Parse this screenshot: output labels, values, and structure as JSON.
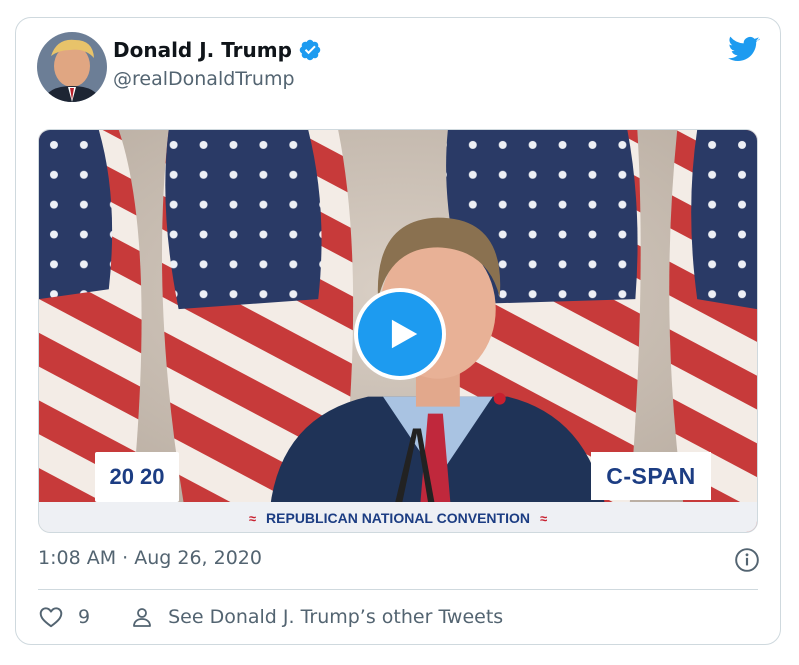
{
  "tweet": {
    "author": {
      "display_name": "Donald J. Trump",
      "handle": "@realDonaldTrump",
      "verified": true,
      "avatar_icon": "profile-photo"
    },
    "brand_icon": "twitter-bird-icon",
    "media": {
      "type": "video",
      "overlay_left_badge": "20 20",
      "overlay_right_badge": "C-SPAN",
      "lower_third_text": "REPUBLICAN NATIONAL CONVENTION",
      "play_icon": "play-icon"
    },
    "timestamp": "1:08 AM · Aug 26, 2020",
    "actions": {
      "like_count": "9",
      "profile_link_label": "See Donald J. Trump’s other Tweets"
    }
  },
  "colors": {
    "accent": "#1d9bf0",
    "text_primary": "#0f1419",
    "text_secondary": "#536471",
    "border": "#cfd9de",
    "convention_blue": "#1c3d83",
    "convention_red": "#c8202f"
  }
}
